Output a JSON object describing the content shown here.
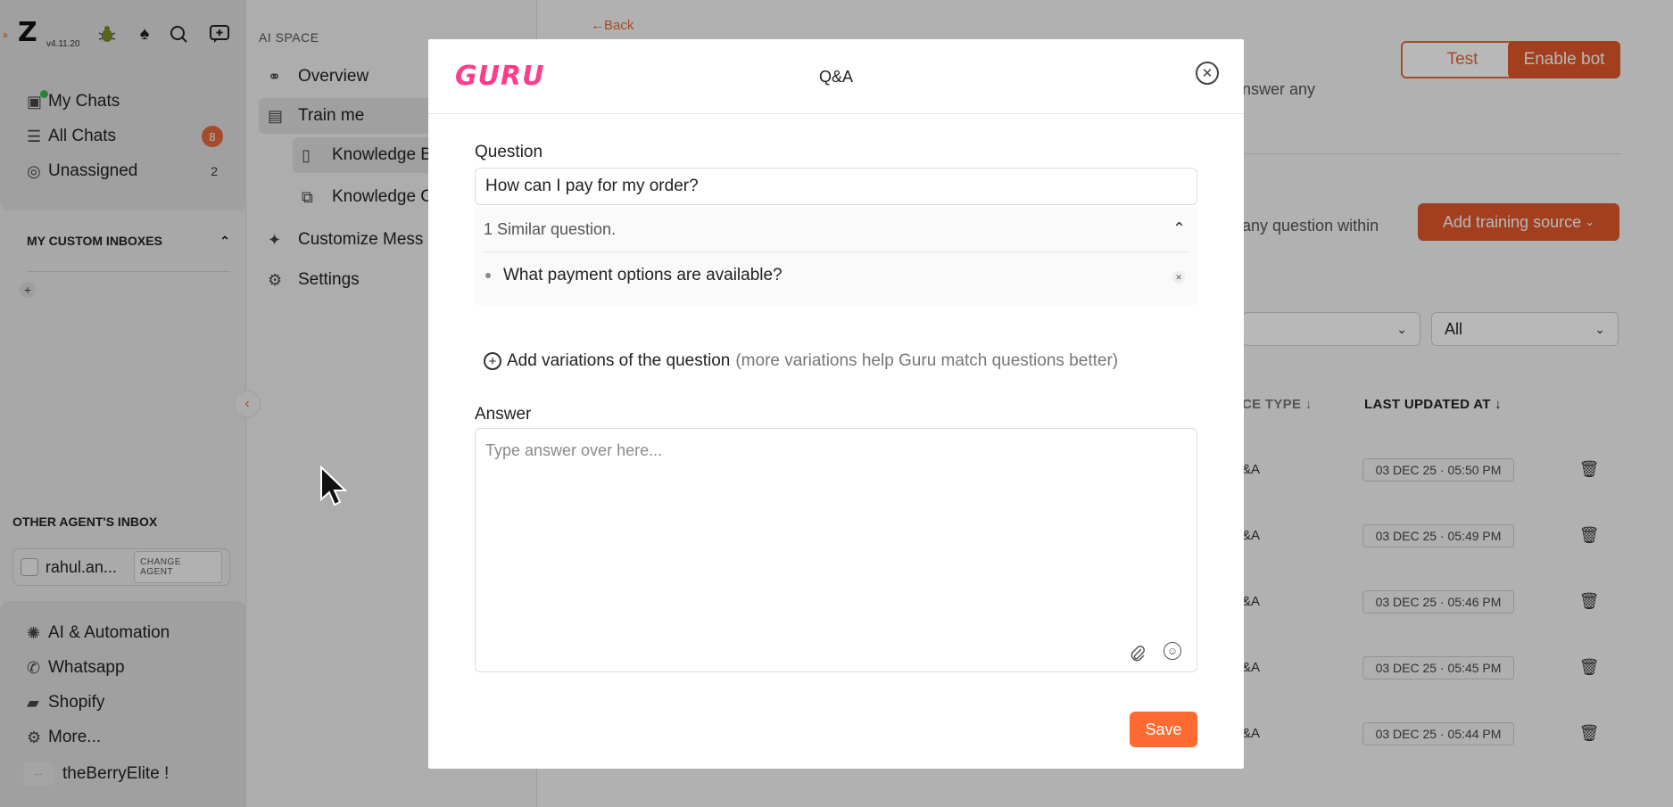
{
  "app": {
    "logo": "Z",
    "version": "v4.11.20"
  },
  "rail": {
    "nav": [
      {
        "label": "My Chats",
        "icon": "chats-icon"
      },
      {
        "label": "All Chats",
        "icon": "filter-icon",
        "badge": "8"
      },
      {
        "label": "Unassigned",
        "icon": "unassigned-icon",
        "count": "2"
      }
    ],
    "custom_inboxes_title": "MY CUSTOM INBOXES",
    "other_inbox_title": "OTHER AGENT'S INBOX",
    "agent_name": "rahul.an...",
    "change_agent_label": "CHANGE AGENT",
    "bottom": [
      {
        "label": "AI & Automation",
        "icon": "openai-icon"
      },
      {
        "label": "Whatsapp",
        "icon": "whatsapp-icon"
      },
      {
        "label": "Shopify",
        "icon": "shopify-icon"
      },
      {
        "label": "More...",
        "icon": "gear-icon"
      }
    ],
    "store_name": "theBerryElite !"
  },
  "subnav": {
    "heading": "AI SPACE",
    "items": [
      {
        "label": "Overview"
      },
      {
        "label": "Train me"
      },
      {
        "label": "Knowledge B"
      },
      {
        "label": "Knowledge C"
      },
      {
        "label": "Customize Mess"
      },
      {
        "label": "Settings"
      }
    ]
  },
  "main": {
    "back_label": "←Back",
    "test_label": "Test",
    "enable_label": "Enable bot",
    "bg_text_1": "nswer any",
    "bg_text_2": "any question within",
    "add_source_label": "Add training source",
    "filter_2_value": "All",
    "col_type": "CE TYPE ↓",
    "col_updated": "LAST UPDATED AT ↓",
    "rows": [
      {
        "type": "&A",
        "date": "03 DEC 25 · 05:50 PM"
      },
      {
        "type": "&A",
        "date": "03 DEC 25 · 05:49 PM"
      },
      {
        "type": "&A",
        "date": "03 DEC 25 · 05:46 PM"
      },
      {
        "type": "&A",
        "date": "03 DEC 25 · 05:45 PM"
      },
      {
        "type": "&A",
        "date": "03 DEC 25 · 05:44 PM"
      }
    ]
  },
  "modal": {
    "logo": "GURU",
    "title": "Q&A",
    "question_label": "Question",
    "question_value": "How can I pay for my order?",
    "similar_header": "1 Similar question.",
    "similar_questions": [
      "What payment options are available?"
    ],
    "add_variation_label": "Add variations of the question",
    "add_variation_hint": "(more variations help Guru match questions better)",
    "answer_label": "Answer",
    "answer_placeholder": "Type answer over here...",
    "save_label": "Save"
  },
  "colors": {
    "accent": "#e0582a",
    "guru_pink": "#ff3d8b",
    "save": "#ff6a33"
  }
}
